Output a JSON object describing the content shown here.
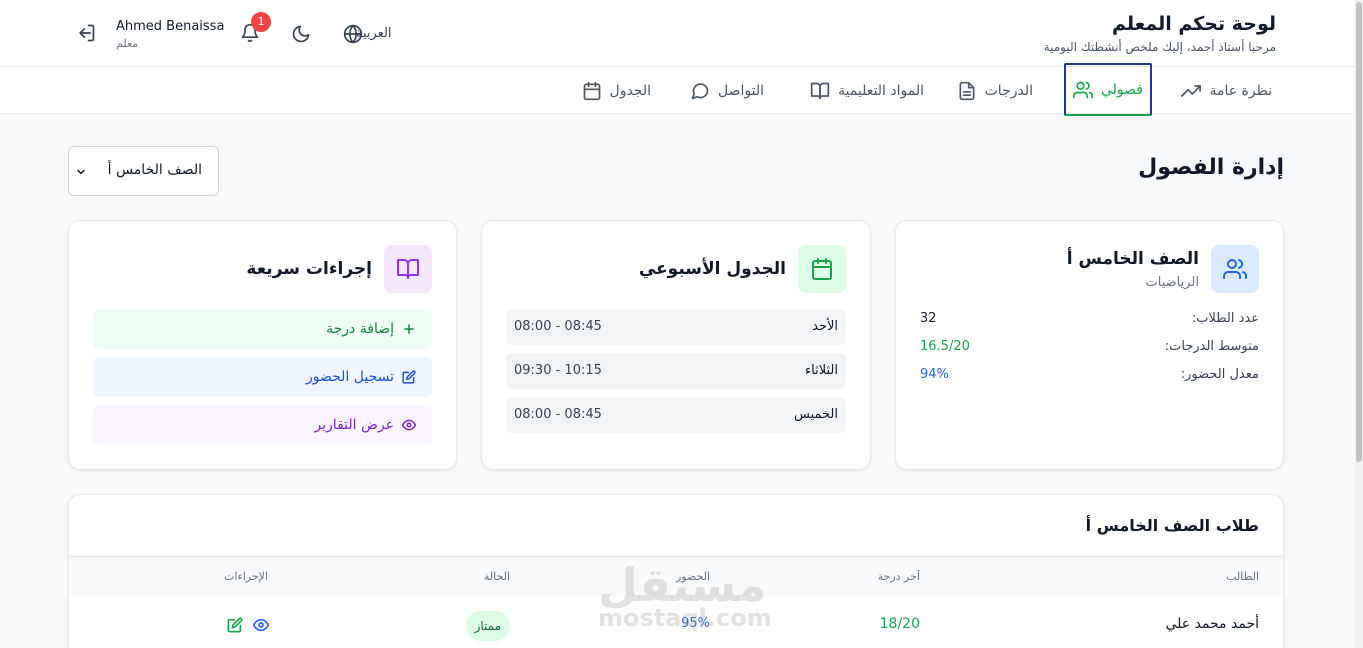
{
  "header": {
    "title": "لوحة تحكم المعلم",
    "subtitle": "مرحبا أستاذ أحمد، إليك ملخص أنشطتك اليومية",
    "user_name": "Ahmed Benaissa",
    "user_role": "معلم",
    "notification_count": "1",
    "language": "العربية"
  },
  "nav": {
    "tabs": [
      {
        "label": "نظرة عامة",
        "icon": "trending-up-icon"
      },
      {
        "label": "فصولي",
        "icon": "users-icon",
        "active": true
      },
      {
        "label": "الدرجات",
        "icon": "file-text-icon"
      },
      {
        "label": "المواد التعليمية",
        "icon": "book-open-icon"
      },
      {
        "label": "التواصل",
        "icon": "message-circle-icon"
      },
      {
        "label": "الجدول",
        "icon": "calendar-icon"
      }
    ]
  },
  "main": {
    "page_title": "إدارة الفصول",
    "selected_class": "الصف الخامس أ"
  },
  "class_card": {
    "title": "الصف الخامس أ",
    "subject": "الرياضيات",
    "stats": [
      {
        "label": "عدد الطلاب:",
        "value": "32",
        "color": "#111827"
      },
      {
        "label": "متوسط الدرجات:",
        "value": "16.5/20",
        "color": "#16a34a"
      },
      {
        "label": "معدل الحضور:",
        "value": "94%",
        "color": "#2563eb"
      }
    ]
  },
  "schedule_card": {
    "title": "الجدول الأسبوعي",
    "rows": [
      {
        "day": "الأحد",
        "time": "08:00 - 08:45"
      },
      {
        "day": "الثلاثاء",
        "time": "09:30 - 10:15"
      },
      {
        "day": "الخميس",
        "time": "08:00 - 08:45"
      }
    ]
  },
  "quick_actions": {
    "title": "إجراءات سريعة",
    "actions": [
      {
        "label": "إضافة درجة",
        "icon": "plus-icon",
        "color": "#15803d",
        "bg": "#f0fdf4"
      },
      {
        "label": "تسجيل الحضور",
        "icon": "edit-icon",
        "color": "#1d4ed8",
        "bg": "#eff6ff"
      },
      {
        "label": "عرض التقارير",
        "icon": "eye-icon",
        "color": "#7e22ce",
        "bg": "#faf5ff"
      }
    ]
  },
  "students": {
    "title": "طلاب الصف الخامس أ",
    "columns": [
      "الطالب",
      "آخر درجة",
      "الحضور",
      "الحالة",
      "الإجراءات"
    ],
    "rows": [
      {
        "name": "أحمد محمد علي",
        "grade": "18/20",
        "attendance": "95%",
        "status": "ممتاز"
      }
    ]
  },
  "watermark": {
    "line1": "مستقل",
    "line2": "mostaql.com"
  }
}
